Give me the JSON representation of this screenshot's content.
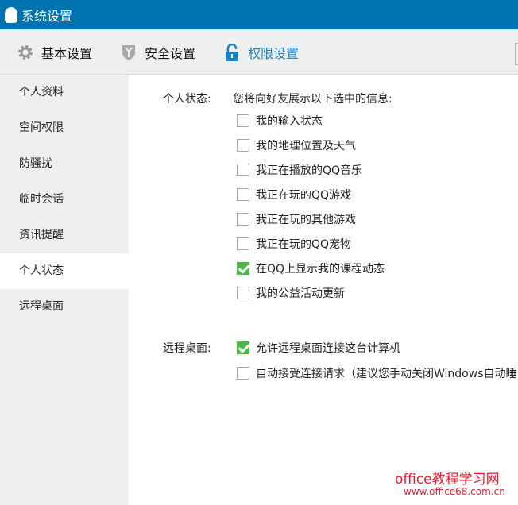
{
  "window": {
    "title": "系统设置"
  },
  "tabs": [
    {
      "label": "基本设置"
    },
    {
      "label": "安全设置"
    },
    {
      "label": "权限设置"
    }
  ],
  "sidebar": {
    "items": [
      {
        "label": "个人资料"
      },
      {
        "label": "空间权限"
      },
      {
        "label": "防骚扰"
      },
      {
        "label": "临时会话"
      },
      {
        "label": "资讯提醒"
      },
      {
        "label": "个人状态"
      },
      {
        "label": "远程桌面"
      }
    ]
  },
  "status": {
    "label": "个人状态:",
    "desc": "您将向好友展示以下选中的信息:",
    "options": [
      {
        "label": "我的输入状态",
        "checked": false
      },
      {
        "label": "我的地理位置及天气",
        "checked": false
      },
      {
        "label": "我正在播放的QQ音乐",
        "checked": false
      },
      {
        "label": "我正在玩的QQ游戏",
        "checked": false
      },
      {
        "label": "我正在玩的其他游戏",
        "checked": false
      },
      {
        "label": "我正在玩的QQ宠物",
        "checked": false
      },
      {
        "label": "在QQ上显示我的课程动态",
        "checked": true
      },
      {
        "label": "我的公益活动更新",
        "checked": false
      }
    ]
  },
  "remote": {
    "label": "远程桌面:",
    "options": [
      {
        "label": "允许远程桌面连接这台计算机",
        "checked": true
      },
      {
        "label": "自动接受连接请求（建议您手动关闭Windows自动睡",
        "checked": false
      }
    ]
  },
  "watermark": {
    "line1": "office教程学习网",
    "line2": "www.office68.com.cn"
  },
  "colors": {
    "titlebar": "#0072ae",
    "accent": "#1a7fc4",
    "check": "#4cb848"
  }
}
